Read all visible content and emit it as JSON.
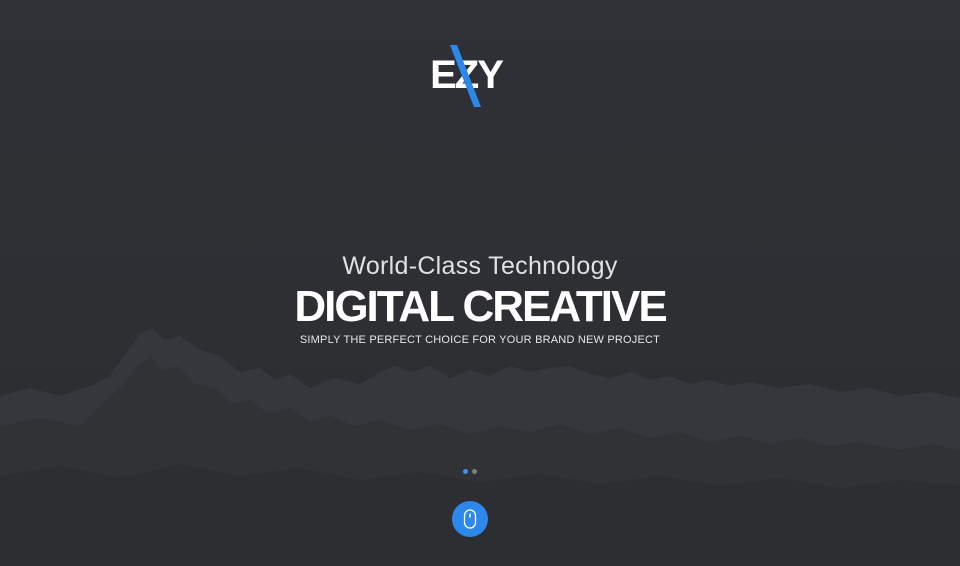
{
  "brand": {
    "logo_text": "EZY",
    "accent_color": "#2d88ec"
  },
  "hero": {
    "pre_title": "World-Class Technology",
    "title": "DIGITAL CREATIVE",
    "subtitle": "SIMPLY THE PERFECT CHOICE FOR YOUR BRAND NEW PROJECT"
  },
  "slider": {
    "dots": [
      {
        "state": "active",
        "color": "#3d8ff0"
      },
      {
        "state": "inactive",
        "color": "#7a7f87"
      }
    ]
  },
  "scroll_button": {
    "icon": "mouse-icon"
  }
}
